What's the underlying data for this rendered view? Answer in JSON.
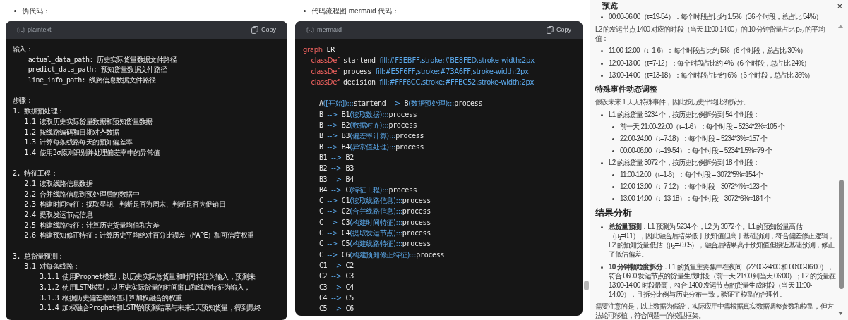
{
  "left": {
    "intro": "伪代码：",
    "code": {
      "language": "plaintext",
      "copy": "Copy",
      "lines": [
        "输入：",
        "    actual_data_path: 历史实际货量数据文件路径",
        "    predict_data_path: 预知货量数据文件路径",
        "    line_info_path: 线路信息数据文件路径",
        {
          "kind": "blank"
        },
        "步骤：",
        "1. 数据预处理：",
        "   1.1 读取历史实际货量数据和预知货量数据",
        "   1.2 按线路编码和日期对齐数据",
        "   1.3 计算每条线路每天的预知偏差率",
        "   1.4 使用3σ原则识别并处理偏差率中的异常值",
        {
          "kind": "blank"
        },
        "2. 特征工程：",
        "   2.1 读取线路信息数据",
        "   2.2 合并线路信息到预处理后的数据中",
        "   2.3 构建时间特征：提取星期、判断是否为周末、判断是否为促销日",
        "   2.4 提取发运节点信息",
        "   2.5 构建线路特征：计算历史货量均值和方差",
        "   2.6 构建预知修正特征：计算历史平均绝对百分比误差（MAPE）和可信度权重",
        {
          "kind": "blank"
        },
        "3. 总货量预测：",
        "   3.1 对每条线路：",
        "       3.1.1 使用Prophet模型，以历史实际总货量和时间特征为输入，预测未",
        "       3.1.2 使用LSTM模型，以历史实际货量的时间窗口和线路特征为输入，",
        "       3.1.3 根据历史偏差率均值计算加权融合的权重",
        "       3.1.4 加权融合Prophet和LSTM的预测结果与未来1天预知货量，得到最终"
      ]
    }
  },
  "middle": {
    "intro": "代码流程图 mermaid 代码：",
    "code": {
      "language": "mermaid",
      "copy": "Copy",
      "lines": [
        [
          {
            "kind": "keyword",
            "text": "graph"
          },
          {
            "kind": "name",
            "text": " LR"
          }
        ],
        [
          {
            "kind": "keyword",
            "text": "    classDef"
          },
          {
            "kind": "name",
            "text": " startend "
          },
          {
            "kind": "value",
            "text": "fill:#F5EBFF,stroke:#BE8FED,stroke-width:2px"
          }
        ],
        [
          {
            "kind": "keyword",
            "text": "    classDef"
          },
          {
            "kind": "name",
            "text": " process "
          },
          {
            "kind": "value",
            "text": "fill:#E5F6FF,stroke:#73A6FF,stroke-width:2px"
          }
        ],
        [
          {
            "kind": "keyword",
            "text": "    classDef"
          },
          {
            "kind": "name",
            "text": " decision "
          },
          {
            "kind": "value",
            "text": "fill:#FFF6CC,stroke:#FFBC52,stroke-width:2px"
          }
        ],
        {
          "kind": "blank"
        },
        [
          {
            "kind": "name",
            "text": "    A"
          },
          {
            "kind": "value",
            "text": "([开始]):::"
          },
          {
            "kind": "name",
            "text": "startend "
          },
          {
            "kind": "value",
            "text": "-->"
          },
          {
            "kind": "name",
            "text": " B"
          },
          {
            "kind": "value",
            "text": "(数据预处理):::"
          },
          {
            "kind": "name",
            "text": "process"
          }
        ],
        [
          {
            "kind": "name",
            "text": "    B "
          },
          {
            "kind": "value",
            "text": "-->"
          },
          {
            "kind": "name",
            "text": " B1"
          },
          {
            "kind": "value",
            "text": "(读取数据):::"
          },
          {
            "kind": "name",
            "text": "process"
          }
        ],
        [
          {
            "kind": "name",
            "text": "    B "
          },
          {
            "kind": "value",
            "text": "-->"
          },
          {
            "kind": "name",
            "text": " B2"
          },
          {
            "kind": "value",
            "text": "(数据对齐):::"
          },
          {
            "kind": "name",
            "text": "process"
          }
        ],
        [
          {
            "kind": "name",
            "text": "    B "
          },
          {
            "kind": "value",
            "text": "-->"
          },
          {
            "kind": "name",
            "text": " B3"
          },
          {
            "kind": "value",
            "text": "(偏差率计算):::"
          },
          {
            "kind": "name",
            "text": "process"
          }
        ],
        [
          {
            "kind": "name",
            "text": "    B "
          },
          {
            "kind": "value",
            "text": "-->"
          },
          {
            "kind": "name",
            "text": " B4"
          },
          {
            "kind": "value",
            "text": "(异常值处理):::"
          },
          {
            "kind": "name",
            "text": "process"
          }
        ],
        [
          {
            "kind": "name",
            "text": "    B1 "
          },
          {
            "kind": "value",
            "text": "-->"
          },
          {
            "kind": "name",
            "text": " B2"
          }
        ],
        [
          {
            "kind": "name",
            "text": "    B2 "
          },
          {
            "kind": "value",
            "text": "-->"
          },
          {
            "kind": "name",
            "text": " B3"
          }
        ],
        [
          {
            "kind": "name",
            "text": "    B3 "
          },
          {
            "kind": "value",
            "text": "-->"
          },
          {
            "kind": "name",
            "text": " B4"
          }
        ],
        [
          {
            "kind": "name",
            "text": "    B4 "
          },
          {
            "kind": "value",
            "text": "-->"
          },
          {
            "kind": "name",
            "text": " C"
          },
          {
            "kind": "value",
            "text": "(特征工程):::"
          },
          {
            "kind": "name",
            "text": "process"
          }
        ],
        [
          {
            "kind": "name",
            "text": "    C "
          },
          {
            "kind": "value",
            "text": "-->"
          },
          {
            "kind": "name",
            "text": " C1"
          },
          {
            "kind": "value",
            "text": "(读取线路信息):::"
          },
          {
            "kind": "name",
            "text": "process"
          }
        ],
        [
          {
            "kind": "name",
            "text": "    C "
          },
          {
            "kind": "value",
            "text": "-->"
          },
          {
            "kind": "name",
            "text": " C2"
          },
          {
            "kind": "value",
            "text": "(合并线路信息):::"
          },
          {
            "kind": "name",
            "text": "process"
          }
        ],
        [
          {
            "kind": "name",
            "text": "    C "
          },
          {
            "kind": "value",
            "text": "-->"
          },
          {
            "kind": "name",
            "text": " C3"
          },
          {
            "kind": "value",
            "text": "(构建时间特征):::"
          },
          {
            "kind": "name",
            "text": "process"
          }
        ],
        [
          {
            "kind": "name",
            "text": "    C "
          },
          {
            "kind": "value",
            "text": "-->"
          },
          {
            "kind": "name",
            "text": " C4"
          },
          {
            "kind": "value",
            "text": "(提取发运节点):::"
          },
          {
            "kind": "name",
            "text": "process"
          }
        ],
        [
          {
            "kind": "name",
            "text": "    C "
          },
          {
            "kind": "value",
            "text": "-->"
          },
          {
            "kind": "name",
            "text": " C5"
          },
          {
            "kind": "value",
            "text": "(构建线路特征):::"
          },
          {
            "kind": "name",
            "text": "process"
          }
        ],
        [
          {
            "kind": "name",
            "text": "    C "
          },
          {
            "kind": "value",
            "text": "-->"
          },
          {
            "kind": "name",
            "text": " C6"
          },
          {
            "kind": "value",
            "text": "(构建预知修正特征):::"
          },
          {
            "kind": "name",
            "text": "process"
          }
        ],
        [
          {
            "kind": "name",
            "text": "    C1 "
          },
          {
            "kind": "value",
            "text": "-->"
          },
          {
            "kind": "name",
            "text": " C2"
          }
        ],
        [
          {
            "kind": "name",
            "text": "    C2 "
          },
          {
            "kind": "value",
            "text": "-->"
          },
          {
            "kind": "name",
            "text": " C3"
          }
        ],
        [
          {
            "kind": "name",
            "text": "    C3 "
          },
          {
            "kind": "value",
            "text": "-->"
          },
          {
            "kind": "name",
            "text": " C4"
          }
        ],
        [
          {
            "kind": "name",
            "text": "    C4 "
          },
          {
            "kind": "value",
            "text": "-->"
          },
          {
            "kind": "name",
            "text": " C5"
          }
        ],
        [
          {
            "kind": "name",
            "text": "    C5 "
          },
          {
            "kind": "value",
            "text": "-->"
          },
          {
            "kind": "name",
            "text": " C6"
          }
        ]
      ]
    }
  },
  "preview": {
    "title": "预览",
    "close": "×",
    "blocks": [
      {
        "kind": "bullet",
        "text": "00:00-06:00（τ=19-54）：每个时段占比约 1.5%（36 个时段，总占比 54%）"
      },
      {
        "kind": "paragraph",
        "text": "L2 的发运节点 1400 对应的时段（当天 11:00-14:00）的 10 分钟货量占比 p$_{2,τ}$ 的平均值："
      },
      {
        "kind": "bullet",
        "text": "11:00-12:00（τ=1-6）：每个时段占比约 5%（6 个时段，总占比 30%）"
      },
      {
        "kind": "bullet",
        "text": "12:00-13:00（τ=7-12）：每个时段占比约 4%（6 个时段，总占比 24%）"
      },
      {
        "kind": "bullet",
        "text": "13:00-14:00（τ=13-18）：每个时段占比约 6%（6 个时段，总占比 36%）"
      },
      {
        "kind": "subheading",
        "text": "特殊事件动态调整"
      },
      {
        "kind": "paragraph",
        "text": "假设未来 1 天无特殊事件，因此按历史平均比例拆分。"
      },
      {
        "kind": "bullet",
        "text": "L1 的总货量 5234 个，按历史比例拆分到 54 个时段：",
        "children": [
          {
            "kind": "bullet",
            "text": "前一天 21:00-22:00（τ=1-6）：每个时段 = 5234*2%≈105 个"
          },
          {
            "kind": "bullet",
            "text": "22:00-24:00（τ=7-18）：每个时段 = 5234*3%≈157 个"
          },
          {
            "kind": "bullet",
            "text": "00:00-06:00（τ=19-54）：每个时段 = 5234*1.5%≈79 个"
          }
        ]
      },
      {
        "kind": "bullet",
        "text": "L2 的总货量 3072 个，按历史比例拆分到 18 个时段：",
        "children": [
          {
            "kind": "bullet",
            "text": "11:00-12:00（τ=1-6）：每个时段 = 3072*5%≈154 个"
          },
          {
            "kind": "bullet",
            "text": "12:00-13:00（τ=7-12）：每个时段 = 3072*4%≈123 个"
          },
          {
            "kind": "bullet",
            "text": "13:00-14:00（τ=13-18）：每个时段 = 3072*6%≈184 个"
          }
        ]
      },
      {
        "kind": "heading",
        "text": "结果分析"
      },
      {
        "kind": "bullet",
        "text": "**总货量预测**：L1 预测为 5234 个，L2 为 3072 个。L1 的预知货量高估（μ$_{1}$=0.1），因此融合后结果低于预知值但高于基础预测，符合偏差修正逻辑；L2 的预知货量低估（μ$_{2}$=-0.05），融合后结果高于预知值但接近基础预测，修正了低估偏差。"
      },
      {
        "kind": "bullet",
        "text": "**10 分钟颗粒度拆分**：L1 的货量主要集中在夜间（22:00-24:00 和 00:00-06:00），符合 0600 发运节点的货量生成时段（前一天 21:00 到当天 06:00）；L2 的货量在 13:00-14:00 时段最高，符合 1400 发运节点的货量生成时段（当天 11:00-14:00），且拆分比例与历史分布一致，验证了模型的合理性。"
      },
      {
        "kind": "paragraph",
        "text": "需要注意的是，以上数据为假设，实际应用中需根据真实数据调整参数和模型，但方法论可移植，符合问题一的模型框架。"
      }
    ]
  }
}
